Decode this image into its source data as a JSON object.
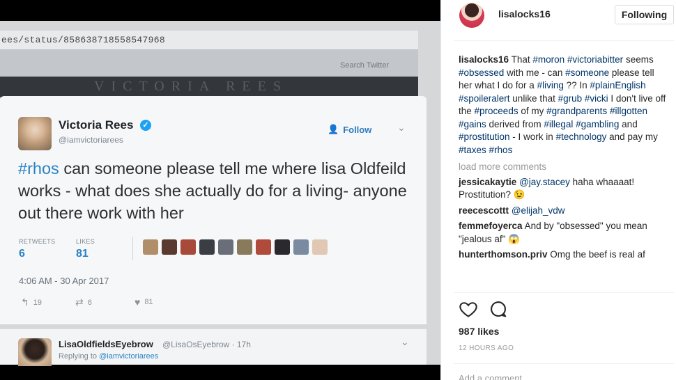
{
  "photo": {
    "url": "ees/status/858638718558547968",
    "search_label": "Search Twitter",
    "banner_text": "VICTORIA REES",
    "tweet": {
      "display_name": "Victoria Rees",
      "handle": "@iamvictoriarees",
      "follow_label": "Follow",
      "hashtag": "#rhos",
      "text": " can someone please tell me where lisa Oldfeild works - what does she actually do for a living- anyone out there work with her",
      "retweets_label": "RETWEETS",
      "retweets_count": "6",
      "likes_label": "LIKES",
      "likes_count": "81",
      "timestamp": "4:06 AM - 30 Apr 2017",
      "reply_count": "19",
      "retweet_count_small": "6",
      "like_count_small": "81",
      "liker_colors": [
        "#b08e6a",
        "#5a3a2e",
        "#a84a3a",
        "#3a3e44",
        "#6a6e78",
        "#8a7a5c",
        "#b04a3a",
        "#2a2a2e",
        "#7a8aa0",
        "#e0c8b4"
      ]
    },
    "reply": {
      "name": "LisaOldfieldsEyebrow",
      "handle": "@LisaOsEyebrow · 17h",
      "replying_prefix": "Replying to ",
      "replying_to": "@iamvictoriarees"
    }
  },
  "instagram": {
    "username": "lisalocks16",
    "following_label": "Following",
    "caption_user": "lisalocks16",
    "load_more": "load more comments",
    "comments": [
      {
        "user": "jessicakaytie",
        "mention": "@jay.stacey",
        "text": " haha whaaaat! Prostitution? 😉"
      },
      {
        "user": "reecescottt",
        "mention": "@elijah_vdw",
        "text": ""
      },
      {
        "user": "femmefoyerca",
        "mention": "",
        "text": "And by \"obsessed\" you mean \"jealous af\" 😱"
      },
      {
        "user": "hunterthomson.priv",
        "mention": "",
        "text": "Omg the beef is real af"
      }
    ],
    "likes": "987 likes",
    "time_ago": "12 HOURS AGO",
    "add_comment": "Add a comment..."
  }
}
